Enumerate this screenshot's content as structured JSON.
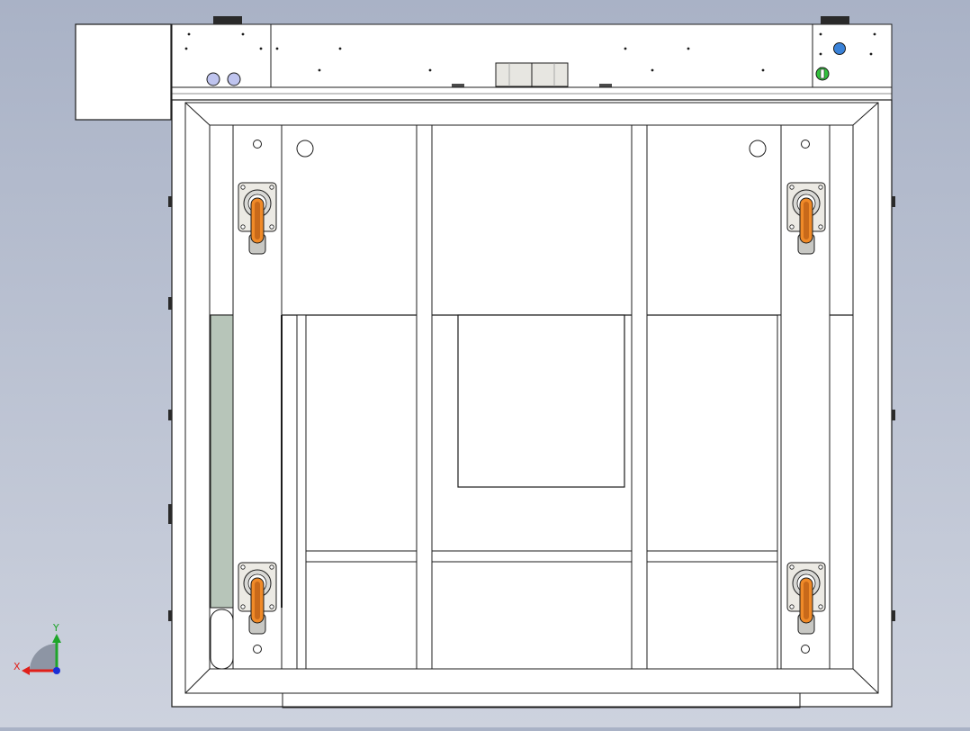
{
  "viewport": {
    "background_top": "#a9b2c6",
    "background_bottom": "#cdd2de"
  },
  "drawing": {
    "line_color": "#1c1c1c",
    "panel_fill": "#ffffff",
    "bracket_fill": "#eceae4",
    "side_strip_fill": "#b7c5b9",
    "wheel_color": "#f08a28",
    "button_colors": [
      "#bfc4ef",
      "#3a82d8",
      "#32c03c"
    ]
  },
  "triad": {
    "x_label": "X",
    "y_label": "Y",
    "x_color": "#e0201a",
    "y_color": "#1ea52a",
    "z_color": "#1a2fd6"
  },
  "casters": [
    "caster-top-left",
    "caster-top-right",
    "caster-bottom-left",
    "caster-bottom-right"
  ]
}
